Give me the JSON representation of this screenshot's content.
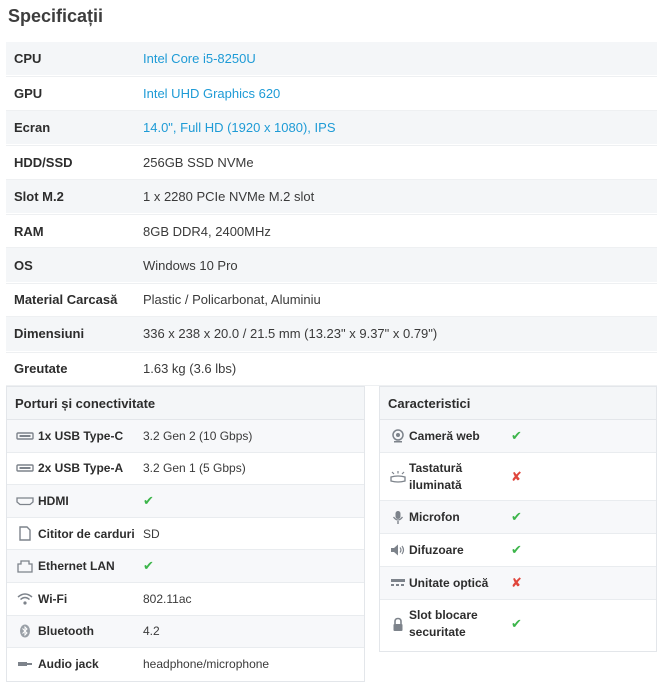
{
  "title": "Specificații",
  "specs": [
    {
      "key": "CPU",
      "value": "Intel Core i5-8250U"
    },
    {
      "key": "GPU",
      "value": "Intel UHD Graphics 620"
    },
    {
      "key": "Ecran",
      "value": "14.0\", Full HD (1920 x 1080), IPS"
    },
    {
      "key": "HDD/SSD",
      "value": "256GB SSD NVMe"
    },
    {
      "key": "Slot M.2",
      "value": "1 x 2280 PCIe NVMe M.2 slot"
    },
    {
      "key": "RAM",
      "value": "8GB DDR4, 2400MHz"
    },
    {
      "key": "OS",
      "value": "Windows 10 Pro"
    },
    {
      "key": "Material Carcasă",
      "value": "Plastic / Policarbonat, Aluminiu"
    },
    {
      "key": "Dimensiuni",
      "value": "336 x 238 x 20.0 / 21.5 mm (13.23\" x 9.37\" x 0.79\")"
    },
    {
      "key": "Greutate",
      "value": "1.63 kg (3.6 lbs)"
    }
  ],
  "ports": {
    "heading": "Porturi și conectivitate",
    "items": [
      {
        "name": "1x USB Type-C",
        "value": "3.2 Gen 2 (10 Gbps)",
        "icon": "usb-icon"
      },
      {
        "name": "2x USB Type-A",
        "value": "3.2 Gen 1 (5 Gbps)",
        "icon": "usb-icon"
      },
      {
        "name": "HDMI",
        "value": "✔",
        "icon": "hdmi-icon"
      },
      {
        "name": "Cititor de carduri",
        "value": "SD",
        "icon": "card-reader-icon"
      },
      {
        "name": "Ethernet LAN",
        "value": "✔",
        "icon": "ethernet-icon"
      },
      {
        "name": "Wi-Fi",
        "value": "802.11ac",
        "icon": "wifi-icon"
      },
      {
        "name": "Bluetooth",
        "value": "4.2",
        "icon": "bluetooth-icon"
      },
      {
        "name": "Audio jack",
        "value": "headphone/microphone",
        "icon": "audio-jack-icon"
      }
    ]
  },
  "features": {
    "heading": "Caracteristici",
    "items": [
      {
        "name": "Cameră web",
        "value": "✔",
        "icon": "webcam-icon"
      },
      {
        "name": "Tastatură iluminată",
        "value": "✘",
        "icon": "backlit-keyboard-icon"
      },
      {
        "name": "Microfon",
        "value": "✔",
        "icon": "microphone-icon"
      },
      {
        "name": "Difuzoare",
        "value": "✔",
        "icon": "speaker-icon"
      },
      {
        "name": "Unitate optică",
        "value": "✘",
        "icon": "optical-drive-icon"
      },
      {
        "name": "Slot blocare securitate",
        "value": "✔",
        "icon": "lock-icon"
      }
    ]
  },
  "colors": {
    "link": "#1e9bd6",
    "check": "#3cb54a",
    "cross": "#e0463c"
  }
}
